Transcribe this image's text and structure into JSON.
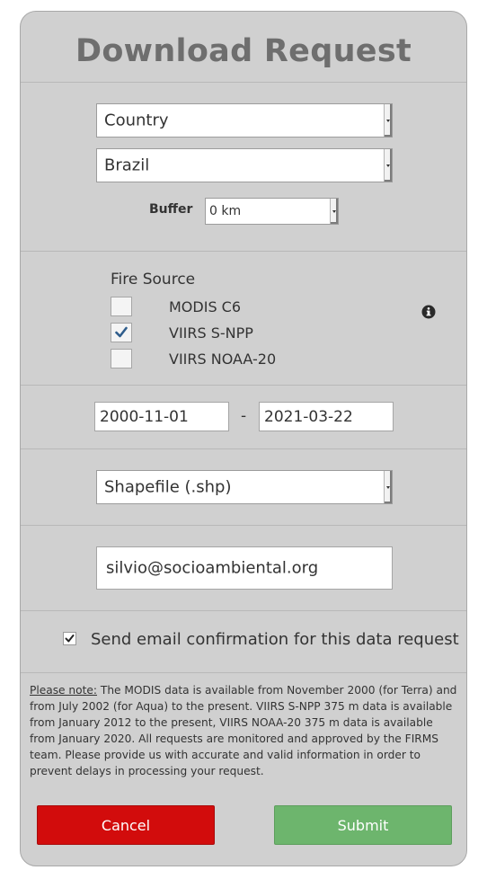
{
  "title": "Download Request",
  "area": {
    "type_select": "Country",
    "country_select": "Brazil",
    "buffer_label": "Buffer",
    "buffer_select": "0 km"
  },
  "fire_source": {
    "label": "Fire Source",
    "options": [
      {
        "label": "MODIS C6",
        "checked": false
      },
      {
        "label": "VIIRS S-NPP",
        "checked": true
      },
      {
        "label": "VIIRS NOAA-20",
        "checked": false
      }
    ],
    "info_icon": "info-icon"
  },
  "dates": {
    "start": "2000-11-01",
    "separator": "-",
    "end": "2021-03-22"
  },
  "format_select": "Shapefile (.shp)",
  "email": "silvio@socioambiental.org",
  "confirmation": {
    "label": "Send email confirmation for this data request",
    "checked": true
  },
  "note": {
    "prefix": "Please note:",
    "text": " The MODIS data is available from November 2000 (for Terra) and from July 2002 (for Aqua) to the present. VIIRS S-NPP 375 m data is available from January 2012 to the present, VIIRS NOAA-20 375 m data is available from January 2020. All requests are monitored and approved by the FIRMS team. Please provide us with accurate and valid information in order to prevent delays in processing your request."
  },
  "buttons": {
    "cancel": "Cancel",
    "submit": "Submit"
  },
  "colors": {
    "panel": "#d0d0d0",
    "cancel": "#d20c0c",
    "submit": "#6db56d",
    "check": "#2f5d8c"
  }
}
